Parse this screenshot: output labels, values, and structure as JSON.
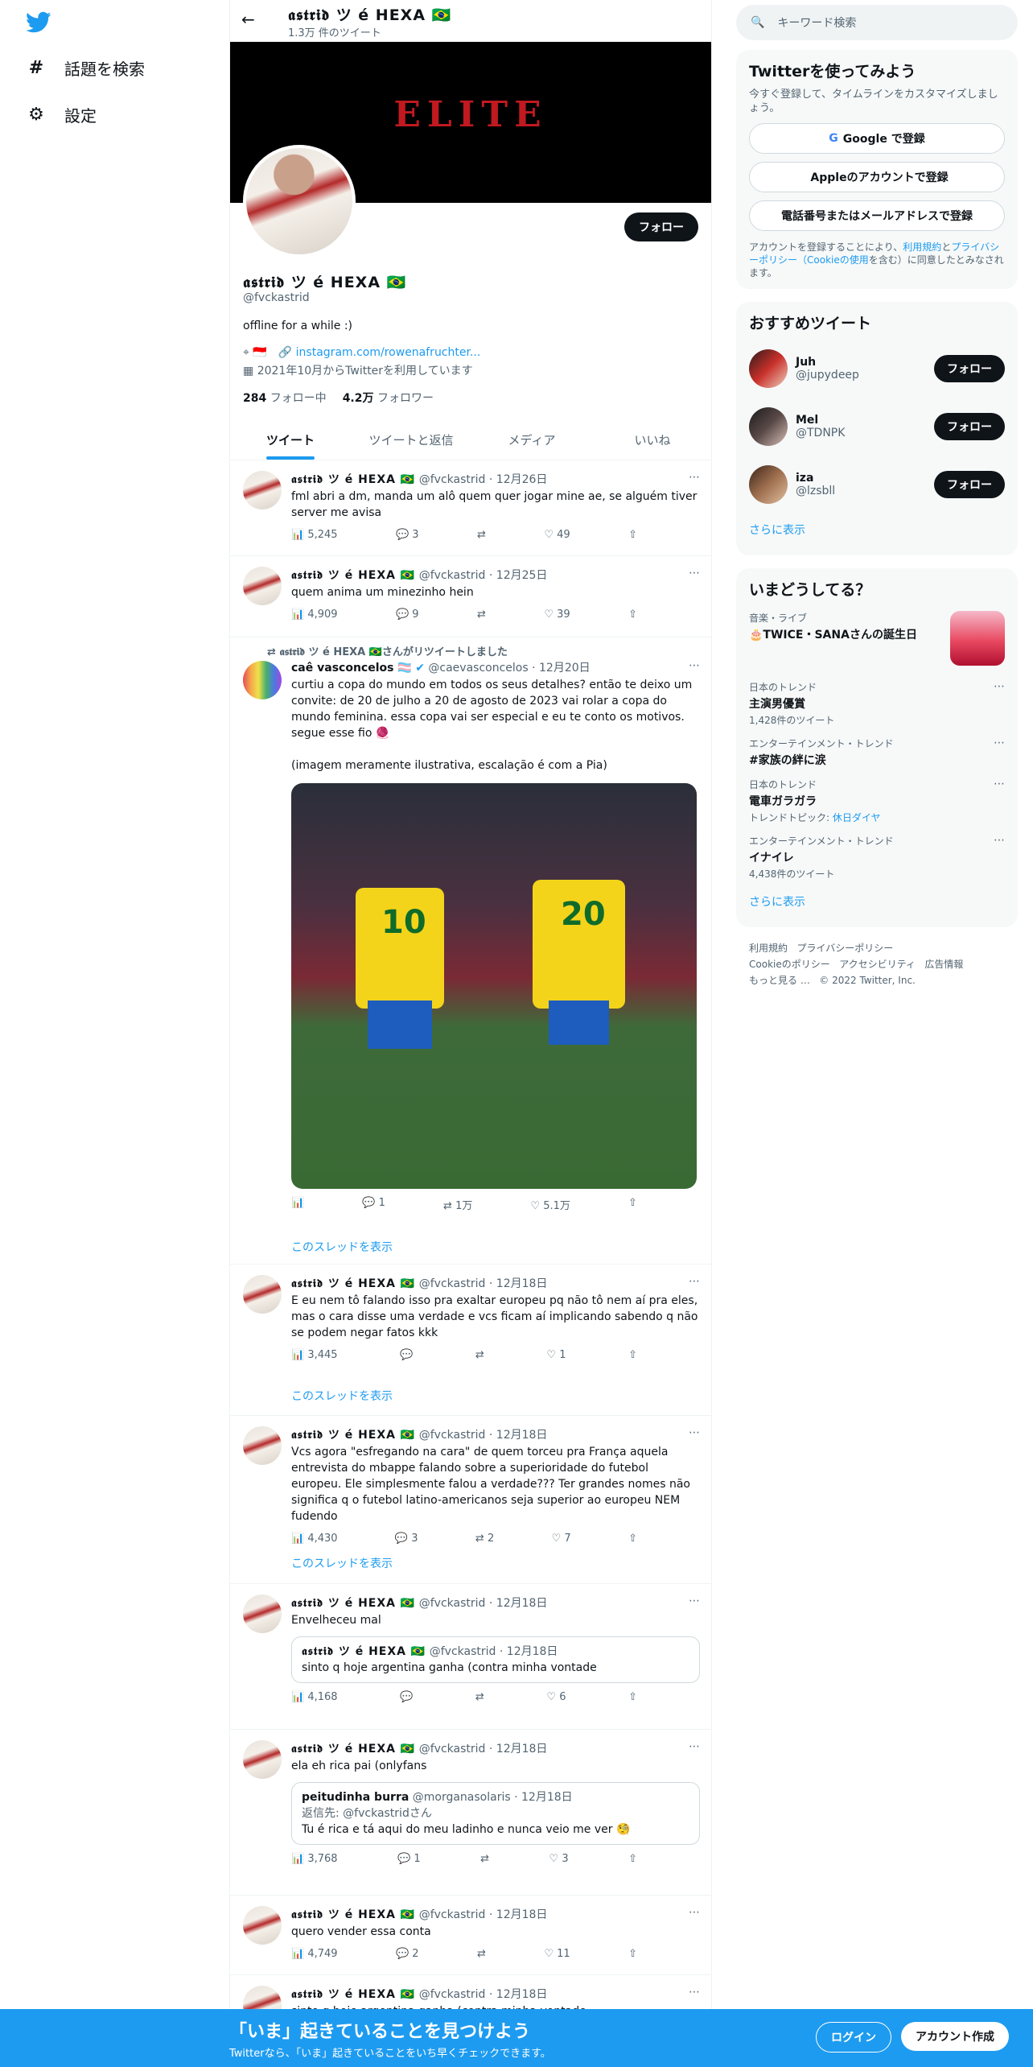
{
  "nav": {
    "explore": "話題を検索",
    "settings": "設定"
  },
  "header": {
    "name": "𝖆𝖘𝖙𝖗𝖎𝖉 ツ é HEXA 🇧🇷",
    "tweet_count": "1.3万 件のツイート"
  },
  "banner": {
    "text": "ELITE"
  },
  "profile": {
    "follow_label": "フォロー",
    "name": "𝖆𝖘𝖙𝖗𝖎𝖉 ツ é HEXA 🇧🇷",
    "handle": "@fvckastrid",
    "bio": "offline for a while :)",
    "location": "🇮🇩",
    "link": "instagram.com/rowenafruchter...",
    "joined": "2021年10月からTwitterを利用しています",
    "following_count": "284",
    "following_label": "フォロー中",
    "followers_count": "4.2万",
    "followers_label": "フォロワー"
  },
  "tabs": [
    "ツイート",
    "ツイートと返信",
    "メディア",
    "いいね"
  ],
  "tweets": [
    {
      "name": "𝖆𝖘𝖙𝖗𝖎𝖉 ツ é HEXA 🇧🇷",
      "handle": "@fvckastrid",
      "date": "12月26日",
      "text": "fml abri a dm, manda um alô quem quer jogar mine ae, se alguém tiver server me avisa",
      "views": "5,245",
      "replies": "3",
      "retweets": "",
      "likes": "49"
    },
    {
      "name": "𝖆𝖘𝖙𝖗𝖎𝖉 ツ é HEXA 🇧🇷",
      "handle": "@fvckastrid",
      "date": "12月25日",
      "text": "quem anima um minezinho hein",
      "views": "4,909",
      "replies": "9",
      "retweets": "",
      "likes": "39"
    },
    {
      "retweet_note": "𝖆𝖘𝖙𝖗𝖎𝖉 ツ é HEXA 🇧🇷さんがリツイートしました",
      "name": "caê vasconcelos 🏳️‍⚧️",
      "handle": "@caevasconcelos",
      "date": "12月20日",
      "text": "curtiu a copa do mundo em todos os seus detalhes? então te deixo um convite: de 20 de julho a 20 de agosto de 2023 vai rolar a copa do mundo feminina. essa copa vai ser especial e eu te conto os motivos. segue esse fio 🧶\n\n(imagem meramente ilustrativa, escalação é com a Pia)",
      "views": "",
      "replies": "1",
      "retweets": "1万",
      "likes": "5.1万",
      "show_thread": "このスレッドを表示"
    },
    {
      "name": "𝖆𝖘𝖙𝖗𝖎𝖉 ツ é HEXA 🇧🇷",
      "handle": "@fvckastrid",
      "date": "12月18日",
      "text": "E eu nem tô falando isso pra exaltar europeu pq não tô nem aí pra eles, mas o cara disse uma verdade e vcs ficam aí implicando sabendo q não se podem negar fatos kkk",
      "views": "3,445",
      "replies": "",
      "retweets": "",
      "likes": "1",
      "show_thread": "このスレッドを表示"
    },
    {
      "name": "𝖆𝖘𝖙𝖗𝖎𝖉 ツ é HEXA 🇧🇷",
      "handle": "@fvckastrid",
      "date": "12月18日",
      "text": "Vcs agora \"esfregando na cara\" de quem torceu pra França aquela entrevista do mbappe falando sobre a superioridade do futebol europeu. Ele simplesmente falou a verdade??? Ter grandes nomes não significa q o futebol latino-americanos seja superior ao europeu NEM fudendo",
      "views": "4,430",
      "replies": "3",
      "retweets": "2",
      "likes": "7",
      "show_thread": "このスレッドを表示"
    },
    {
      "name": "𝖆𝖘𝖙𝖗𝖎𝖉 ツ é HEXA 🇧🇷",
      "handle": "@fvckastrid",
      "date": "12月18日",
      "text": "Envelheceu mal",
      "quote_name": "𝖆𝖘𝖙𝖗𝖎𝖉 ツ é HEXA 🇧🇷",
      "quote_handle": "@fvckastrid",
      "quote_date": "12月18日",
      "quote_text": "sinto q hoje argentina ganha (contra minha vontade",
      "views": "4,168",
      "replies": "",
      "retweets": "",
      "likes": "6"
    },
    {
      "name": "𝖆𝖘𝖙𝖗𝖎𝖉 ツ é HEXA 🇧🇷",
      "handle": "@fvckastrid",
      "date": "12月18日",
      "text": "ela eh rica pai (onlyfans",
      "quote_name": "peitudinha burra",
      "quote_handle": "@morganasolaris",
      "quote_date": "12月18日",
      "quote_reply": "返信先: @fvckastridさん",
      "quote_text": "Tu é rica e tá aqui do meu ladinho e nunca veio me ver 🧐",
      "views": "3,768",
      "replies": "1",
      "retweets": "",
      "likes": "3"
    },
    {
      "name": "𝖆𝖘𝖙𝖗𝖎𝖉 ツ é HEXA 🇧🇷",
      "handle": "@fvckastrid",
      "date": "12月18日",
      "text": "quero vender essa conta",
      "views": "4,749",
      "replies": "2",
      "retweets": "",
      "likes": "11"
    },
    {
      "name": "𝖆𝖘𝖙𝖗𝖎𝖉 ツ é HEXA 🇧🇷",
      "handle": "@fvckastrid",
      "date": "12月18日",
      "text": "sinto q hoje argentina ganha (contra minha vontade"
    }
  ],
  "right": {
    "search_placeholder": "キーワード検索",
    "signup_title": "Twitterを使ってみよう",
    "signup_desc": "今すぐ登録して、タイムラインをカスタマイズしましょう。",
    "google_btn": "Google で登録",
    "apple_btn": "Appleのアカウントで登録",
    "phone_btn": "電話番号またはメールアドレスで登録",
    "legal_pre": "アカウントを登録することにより、",
    "legal_terms": "利用規約",
    "legal_and": "と",
    "legal_privacy": "プライバシーポリシー（Cookieの使用",
    "legal_post": "を含む）に同意したとみなされます。",
    "rec_title": "おすすめツイート",
    "recs": [
      {
        "name": "Juh",
        "handle": "@jupydeep",
        "follow": "フォロー"
      },
      {
        "name": "Mel",
        "handle": "@TDNPK",
        "follow": "フォロー"
      },
      {
        "name": "iza",
        "handle": "@lzsbll",
        "follow": "フォロー"
      }
    ],
    "show_more": "さらに表示",
    "trends_title": "いまどうしてる？",
    "trends": [
      {
        "cat": "音楽・ライブ",
        "title": "🎂TWICE・SANAさんの誕生日",
        "sub": ""
      },
      {
        "cat": "日本のトレンド",
        "title": "主演男優賞",
        "sub": "1,428件のツイート"
      },
      {
        "cat": "エンターテインメント・トレンド",
        "title": "#家族の絆に涙",
        "sub": ""
      },
      {
        "cat": "日本のトレンド",
        "title": "電車ガラガラ",
        "sub": "トレンドトピック: ",
        "sub_link": "休日ダイヤ"
      },
      {
        "cat": "エンターテインメント・トレンド",
        "title": "イナイレ",
        "sub": "4,438件のツイート"
      }
    ],
    "footer": [
      "利用規約",
      "プライバシーポリシー",
      "Cookieのポリシー",
      "アクセシビリティ",
      "広告情報",
      "もっと見る …",
      "© 2022 Twitter, Inc."
    ]
  },
  "bottom": {
    "title": "「いま」起きていることを見つけよう",
    "sub": "Twitterなら、「いま」起きていることをいち早くチェックできます。",
    "login": "ログイン",
    "signup": "アカウント作成"
  }
}
